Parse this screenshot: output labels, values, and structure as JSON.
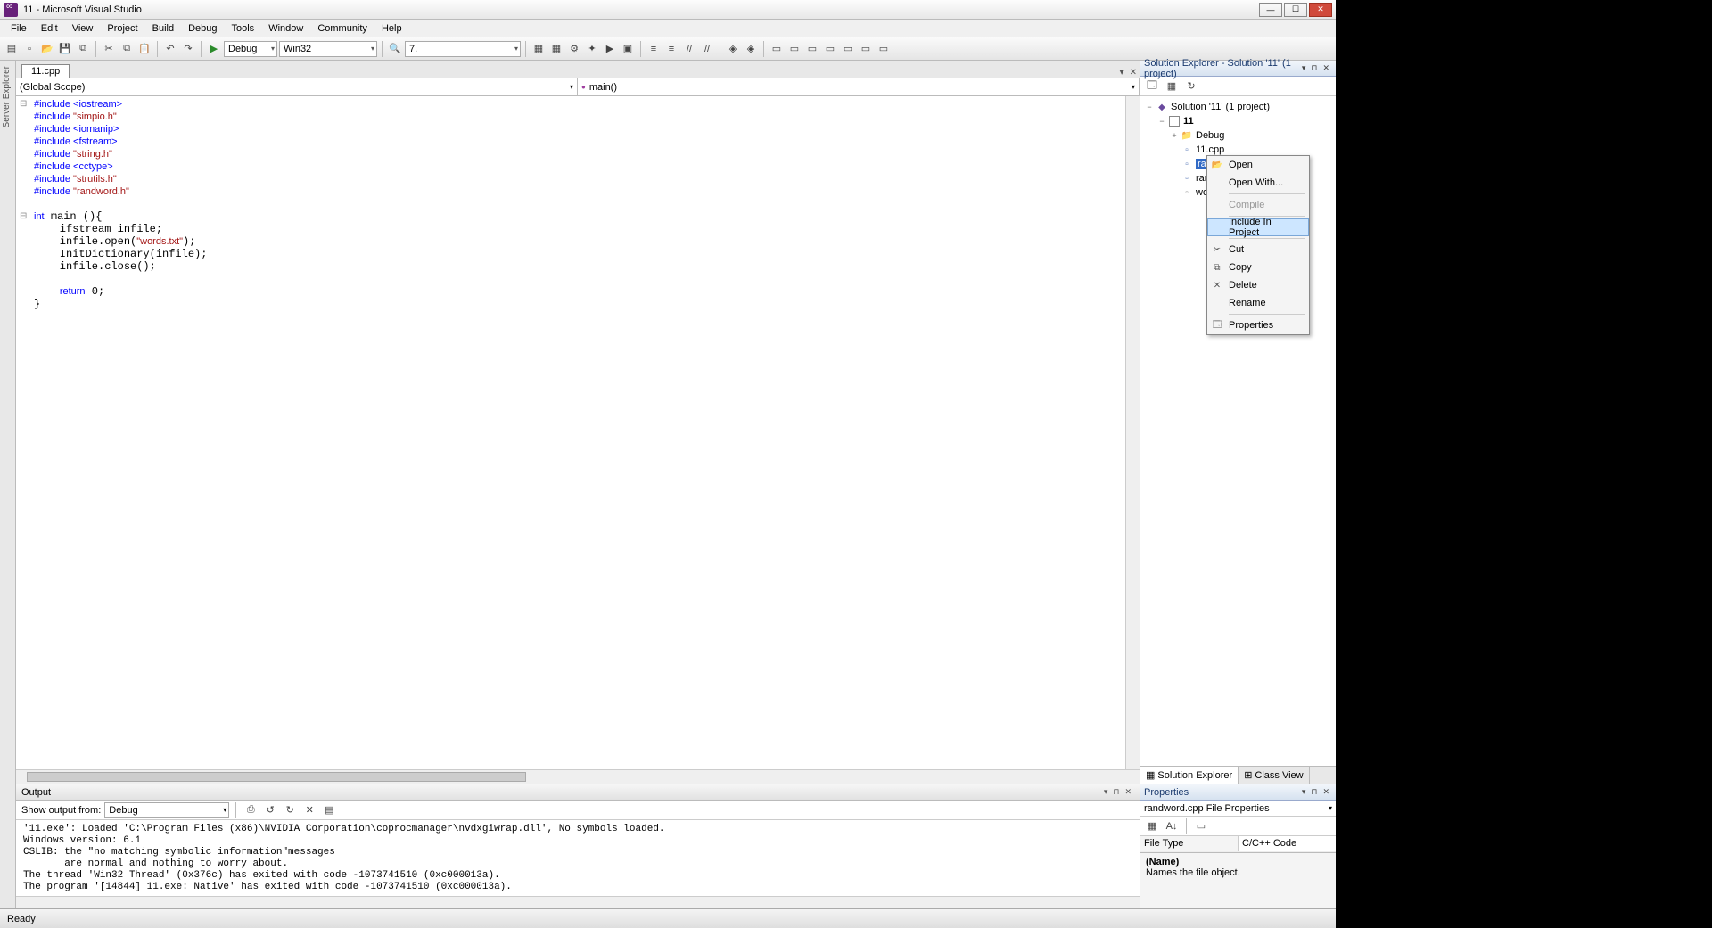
{
  "window": {
    "title": "11 - Microsoft Visual Studio"
  },
  "menu": [
    "File",
    "Edit",
    "View",
    "Project",
    "Build",
    "Debug",
    "Tools",
    "Window",
    "Community",
    "Help"
  ],
  "toolbar": {
    "config": "Debug",
    "platform": "Win32",
    "find": "7."
  },
  "doctab": "11.cpp",
  "scope": {
    "left": "(Global Scope)",
    "right": "main()"
  },
  "code_lines": [
    {
      "t": "pp",
      "text": "#include <iostream>"
    },
    {
      "t": "ppstr",
      "pp": "#include ",
      "str": "\"simpio.h\""
    },
    {
      "t": "pp",
      "text": "#include <iomanip>"
    },
    {
      "t": "pp",
      "text": "#include <fstream>"
    },
    {
      "t": "ppstr",
      "pp": "#include ",
      "str": "\"string.h\""
    },
    {
      "t": "pp",
      "text": "#include <cctype>"
    },
    {
      "t": "ppstr",
      "pp": "#include ",
      "str": "\"strutils.h\""
    },
    {
      "t": "ppstr",
      "pp": "#include ",
      "str": "\"randword.h\""
    },
    {
      "t": "blank"
    },
    {
      "t": "main",
      "kw": "int",
      "rest": " main (){",
      "fold": true
    },
    {
      "t": "line",
      "text": "    ifstream infile;"
    },
    {
      "t": "stmt",
      "pre": "    infile.open(",
      "str": "\"words.txt\"",
      "post": ");"
    },
    {
      "t": "line",
      "text": "    InitDictionary(infile);"
    },
    {
      "t": "line",
      "text": "    infile.close();"
    },
    {
      "t": "blank"
    },
    {
      "t": "ret",
      "pre": "    ",
      "kw": "return",
      "post": " 0;"
    },
    {
      "t": "line",
      "text": "}"
    }
  ],
  "output": {
    "title": "Output",
    "show_label": "Show output from:",
    "source": "Debug",
    "lines": [
      "'11.exe': Loaded 'C:\\Program Files (x86)\\NVIDIA Corporation\\coprocmanager\\nvdxgiwrap.dll', No symbols loaded.",
      "Windows version: 6.1",
      "CSLIB: the \"no matching symbolic information\"messages",
      "       are normal and nothing to worry about.",
      "The thread 'Win32 Thread' (0x376c) has exited with code -1073741510 (0xc000013a).",
      "The program '[14844] 11.exe: Native' has exited with code -1073741510 (0xc000013a)."
    ]
  },
  "solution_explorer": {
    "title": "Solution Explorer - Solution '11' (1 project)",
    "root": "Solution '11' (1 project)",
    "project": "11",
    "folder": "Debug",
    "files": [
      "11.cpp",
      "randword.cpp",
      "randword.h",
      "words.txt"
    ],
    "selected_file": "randword.cpp",
    "tabs": {
      "se": "Solution Explorer",
      "cv": "Class View"
    }
  },
  "context_menu": {
    "items": [
      {
        "label": "Open",
        "icon": "📂"
      },
      {
        "label": "Open With...",
        "icon": ""
      },
      {
        "label": "Compile",
        "icon": "",
        "disabled": true
      },
      {
        "label": "Include In Project",
        "icon": "",
        "hover": true
      },
      {
        "label": "Cut",
        "icon": "✂"
      },
      {
        "label": "Copy",
        "icon": "⧉"
      },
      {
        "label": "Delete",
        "icon": "✕"
      },
      {
        "label": "Rename",
        "icon": ""
      },
      {
        "label": "Properties",
        "icon": "🗔"
      }
    ]
  },
  "properties": {
    "title": "Properties",
    "object": "randword.cpp File Properties",
    "row_key": "File Type",
    "row_val": "C/C++ Code",
    "desc_name": "(Name)",
    "desc_text": "Names the file object."
  },
  "status": "Ready",
  "left_tab": "Server Explorer"
}
